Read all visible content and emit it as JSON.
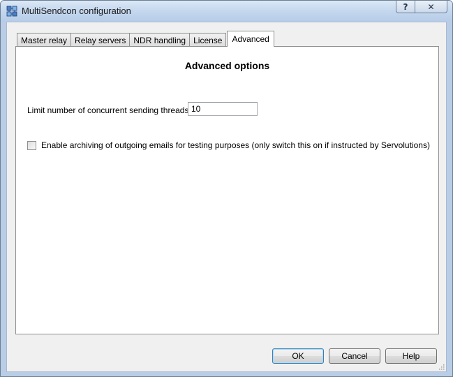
{
  "window": {
    "title": "MultiSendcon configuration",
    "help_glyph": "?",
    "close_glyph": "✕"
  },
  "tabs": [
    {
      "label": "Master relay",
      "active": false
    },
    {
      "label": "Relay servers",
      "active": false
    },
    {
      "label": "NDR handling",
      "active": false
    },
    {
      "label": "License",
      "active": false
    },
    {
      "label": "Advanced",
      "active": true
    }
  ],
  "advanced": {
    "heading": "Advanced options",
    "threads_label": "Limit number of concurrent sending threads to:",
    "threads_value": "10",
    "archive_label": "Enable archiving of outgoing emails for testing purposes (only switch this on if instructed by Servolutions)",
    "archive_checked": false
  },
  "buttons": {
    "ok": "OK",
    "cancel": "Cancel",
    "help": "Help"
  },
  "icons": {
    "app": "network-config-icon",
    "help": "help-icon",
    "close": "close-icon",
    "grip": "resize-grip-icon"
  },
  "colors": {
    "titlebar": "#c4d7ee",
    "dialog_bg": "#f0f0f0",
    "panel_bg": "#ffffff",
    "default_button_border": "#3c7fb1"
  }
}
